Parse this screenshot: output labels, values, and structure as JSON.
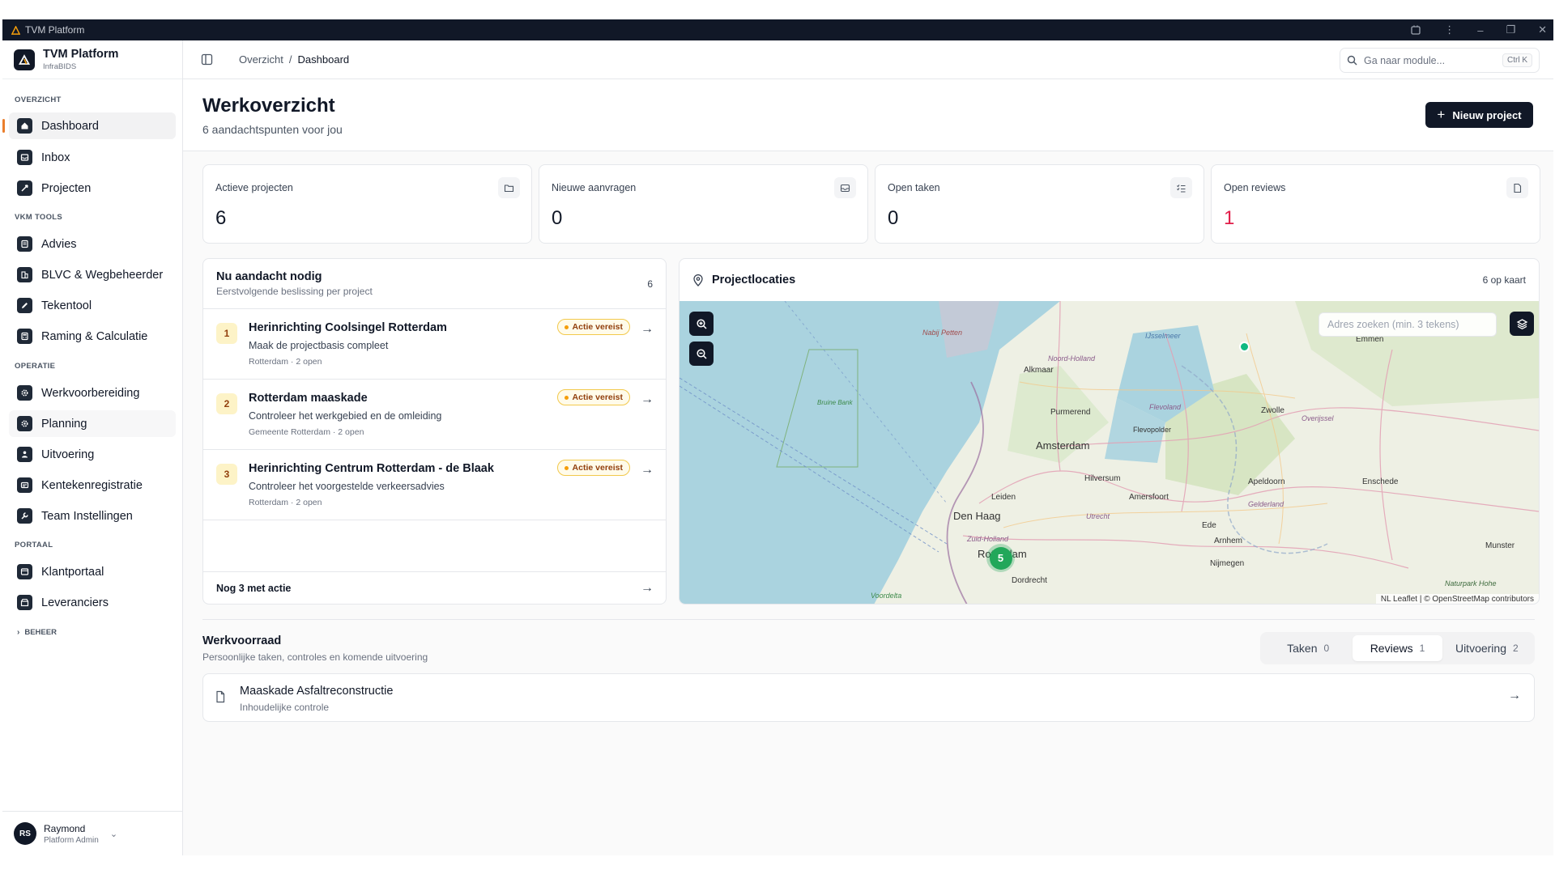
{
  "window": {
    "title": "TVM Platform"
  },
  "brand": {
    "name": "TVM Platform",
    "sub": "InfraBIDS"
  },
  "sidebar": {
    "sections": [
      {
        "label": "OVERZICHT",
        "items": [
          {
            "label": "Dashboard",
            "icon": "home-icon"
          },
          {
            "label": "Inbox",
            "icon": "inbox-icon"
          },
          {
            "label": "Projecten",
            "icon": "rocket-icon"
          }
        ]
      },
      {
        "label": "VKM TOOLS",
        "items": [
          {
            "label": "Advies",
            "icon": "advice-icon"
          },
          {
            "label": "BLVC & Wegbeheerder",
            "icon": "building-icon"
          },
          {
            "label": "Tekentool",
            "icon": "pen-icon"
          },
          {
            "label": "Raming & Calculatie",
            "icon": "calculator-icon"
          }
        ]
      },
      {
        "label": "OPERATIE",
        "items": [
          {
            "label": "Werkvoorbereiding",
            "icon": "gear-icon"
          },
          {
            "label": "Planning",
            "icon": "gear-icon"
          },
          {
            "label": "Uitvoering",
            "icon": "worker-icon"
          },
          {
            "label": "Kentekenregistratie",
            "icon": "id-card-icon"
          },
          {
            "label": "Team Instellingen",
            "icon": "wrench-icon"
          }
        ]
      },
      {
        "label": "PORTAAL",
        "items": [
          {
            "label": "Klantportaal",
            "icon": "portal-icon"
          },
          {
            "label": "Leveranciers",
            "icon": "supplier-icon"
          }
        ]
      }
    ],
    "beheer": "BEHEER",
    "user": {
      "initials": "RS",
      "name": "Raymond",
      "role": "Platform Admin"
    }
  },
  "topbar": {
    "breadcrumb": [
      "Overzicht",
      "Dashboard"
    ],
    "search_placeholder": "Ga naar module...",
    "search_shortcut": "Ctrl K"
  },
  "page": {
    "title": "Werkoverzicht",
    "subtitle": "6 aandachtspunten voor jou",
    "new_project": "Nieuw project"
  },
  "stats": [
    {
      "label": "Actieve projecten",
      "value": "6",
      "icon": "folder-icon"
    },
    {
      "label": "Nieuwe aanvragen",
      "value": "0",
      "icon": "inbox-icon"
    },
    {
      "label": "Open taken",
      "value": "0",
      "icon": "checklist-icon"
    },
    {
      "label": "Open reviews",
      "value": "1",
      "icon": "document-icon"
    }
  ],
  "attention": {
    "title": "Nu aandacht nodig",
    "subtitle": "Eerstvolgende beslissing per project",
    "count": "6",
    "items": [
      {
        "num": "1",
        "name": "Herinrichting Coolsingel Rotterdam",
        "desc": "Maak de projectbasis compleet",
        "meta": "Rotterdam · 2 open",
        "badge": "Actie vereist"
      },
      {
        "num": "2",
        "name": "Rotterdam maaskade",
        "desc": "Controleer het werkgebied en de omleiding",
        "meta": "Gemeente Rotterdam · 2 open",
        "badge": "Actie vereist"
      },
      {
        "num": "3",
        "name": "Herinrichting Centrum Rotterdam - de Blaak",
        "desc": "Controleer het voorgestelde verkeersadvies",
        "meta": "Rotterdam · 2 open",
        "badge": "Actie vereist"
      }
    ],
    "footer": "Nog 3 met actie"
  },
  "map": {
    "title": "Projectlocaties",
    "count": "6 op kaart",
    "search_placeholder": "Adres zoeken (min. 3 tekens)",
    "cluster": "5",
    "attribution": "NL Leaflet | © OpenStreetMap contributors",
    "places": [
      {
        "name": "Nabij Petten"
      },
      {
        "name": "IJsselmeer"
      },
      {
        "name": "Emmen"
      },
      {
        "name": "Noord-Holland"
      },
      {
        "name": "Alkmaar"
      },
      {
        "name": "Bruine Bank"
      },
      {
        "name": "Purmerend"
      },
      {
        "name": "Flevoland"
      },
      {
        "name": "Zwolle"
      },
      {
        "name": "Overijssel"
      },
      {
        "name": "Flevopolder"
      },
      {
        "name": "Amsterdam"
      },
      {
        "name": "Hilversum"
      },
      {
        "name": "Apeldoorn"
      },
      {
        "name": "Enschede"
      },
      {
        "name": "Leiden"
      },
      {
        "name": "Amersfoort"
      },
      {
        "name": "Gelderland"
      },
      {
        "name": "Den Haag"
      },
      {
        "name": "Utrecht"
      },
      {
        "name": "Ede"
      },
      {
        "name": "Zuid-Holland"
      },
      {
        "name": "Arnhem"
      },
      {
        "name": "Munster"
      },
      {
        "name": "Rotterdam"
      },
      {
        "name": "Nijmegen"
      },
      {
        "name": "Dordrecht"
      },
      {
        "name": "Voordelta"
      },
      {
        "name": "Naturpark Hohe"
      }
    ]
  },
  "werkvoorraad": {
    "title": "Werkvoorraad",
    "subtitle": "Persoonlijke taken, controles en komende uitvoering",
    "tabs": [
      {
        "label": "Taken",
        "count": "0"
      },
      {
        "label": "Reviews",
        "count": "1"
      },
      {
        "label": "Uitvoering",
        "count": "2"
      }
    ],
    "row": {
      "name": "Maaskade Asfaltreconstructie",
      "sub": "Inhoudelijke controle"
    }
  },
  "colors": {
    "accent": "#ea7e2c",
    "dark": "#111827",
    "danger": "#e11d48",
    "map_water": "#aad3df",
    "cluster": "#22a75a"
  }
}
